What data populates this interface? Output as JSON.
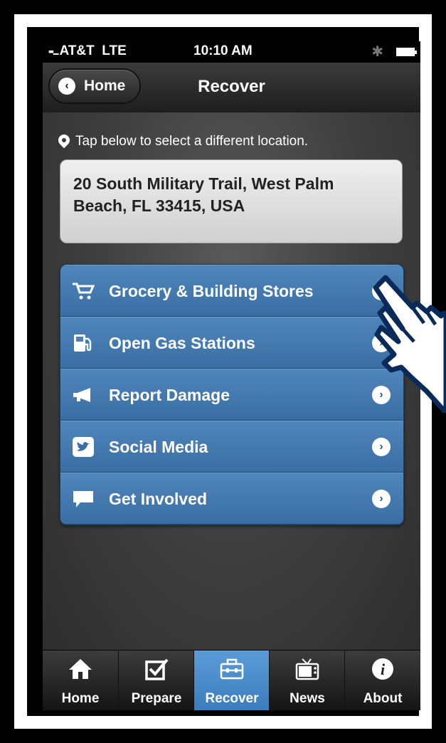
{
  "status_bar": {
    "carrier": "AT&T",
    "network": "LTE",
    "time": "10:10 AM"
  },
  "nav": {
    "back_label": "Home",
    "title": "Recover"
  },
  "location": {
    "hint": "Tap below to select a different location.",
    "address": "20 South Military Trail, West Palm Beach, FL 33415, USA"
  },
  "menu": [
    {
      "label": "Grocery & Building Stores",
      "icon": "cart-icon"
    },
    {
      "label": "Open Gas Stations",
      "icon": "gas-pump-icon"
    },
    {
      "label": "Report Damage",
      "icon": "megaphone-icon"
    },
    {
      "label": "Social Media",
      "icon": "twitter-icon"
    },
    {
      "label": "Get Involved",
      "icon": "speech-bubble-icon"
    }
  ],
  "tabs": [
    {
      "label": "Home",
      "icon": "house-icon",
      "active": false
    },
    {
      "label": "Prepare",
      "icon": "checkbox-icon",
      "active": false
    },
    {
      "label": "Recover",
      "icon": "toolbox-icon",
      "active": true
    },
    {
      "label": "News",
      "icon": "tv-icon",
      "active": false
    },
    {
      "label": "About",
      "icon": "info-icon",
      "active": false
    }
  ],
  "colors": {
    "menu_blue": "#4a80b6",
    "active_tab": "#4a8bcb",
    "background": "#3d3d3d"
  }
}
